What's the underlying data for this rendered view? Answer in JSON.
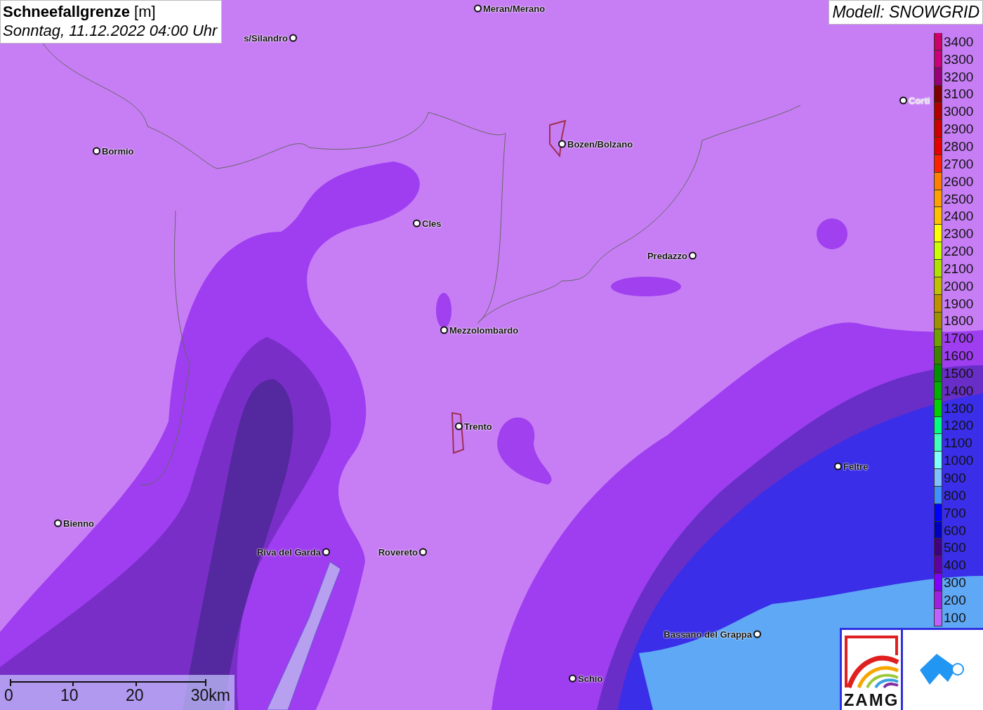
{
  "header": {
    "title": "Schneefallgrenze",
    "unit": "[m]",
    "datetime": "Sonntag, 11.12.2022 04:00 Uhr"
  },
  "model_label": "Modell: SNOWGRID",
  "legend": [
    {
      "value": "3400",
      "color": "#cc0066"
    },
    {
      "value": "3300",
      "color": "#c8007a"
    },
    {
      "value": "3200",
      "color": "#990077"
    },
    {
      "value": "3100",
      "color": "#800000"
    },
    {
      "value": "3000",
      "color": "#b00000"
    },
    {
      "value": "2900",
      "color": "#cc0000"
    },
    {
      "value": "2800",
      "color": "#e60000"
    },
    {
      "value": "2700",
      "color": "#ff2200"
    },
    {
      "value": "2600",
      "color": "#ff8000"
    },
    {
      "value": "2500",
      "color": "#ffa000"
    },
    {
      "value": "2400",
      "color": "#ffc000"
    },
    {
      "value": "2300",
      "color": "#ffff00"
    },
    {
      "value": "2200",
      "color": "#ccff00"
    },
    {
      "value": "2100",
      "color": "#b0e000"
    },
    {
      "value": "2000",
      "color": "#c0c000"
    },
    {
      "value": "1900",
      "color": "#c09000"
    },
    {
      "value": "1800",
      "color": "#a09000"
    },
    {
      "value": "1700",
      "color": "#70a000"
    },
    {
      "value": "1600",
      "color": "#408000"
    },
    {
      "value": "1500",
      "color": "#009000"
    },
    {
      "value": "1400",
      "color": "#00b000"
    },
    {
      "value": "1300",
      "color": "#00d000"
    },
    {
      "value": "1200",
      "color": "#00ff80"
    },
    {
      "value": "1100",
      "color": "#40ffc0"
    },
    {
      "value": "1000",
      "color": "#80ffff"
    },
    {
      "value": "900",
      "color": "#80c0ff"
    },
    {
      "value": "800",
      "color": "#4090ff"
    },
    {
      "value": "700",
      "color": "#0000ff"
    },
    {
      "value": "600",
      "color": "#0000c0"
    },
    {
      "value": "500",
      "color": "#400080"
    },
    {
      "value": "400",
      "color": "#6000a0"
    },
    {
      "value": "300",
      "color": "#8000ff"
    },
    {
      "value": "200",
      "color": "#a020e0"
    },
    {
      "value": "100",
      "color": "#c060ff"
    }
  ],
  "cities": [
    {
      "name": "Meran/Merano"
    },
    {
      "name": "s/Silandro"
    },
    {
      "name": "Bormio"
    },
    {
      "name": "Bozen/Bolzano"
    },
    {
      "name": "Cles"
    },
    {
      "name": "Predazzo"
    },
    {
      "name": "Mezzolombardo"
    },
    {
      "name": "Trento"
    },
    {
      "name": "Feltre"
    },
    {
      "name": "Bienno"
    },
    {
      "name": "Riva del Garda"
    },
    {
      "name": "Rovereto"
    },
    {
      "name": "Bassano del Grappa"
    },
    {
      "name": "Schio"
    },
    {
      "name": "Corti"
    }
  ],
  "scale": {
    "ticks": [
      "0",
      "10",
      "20",
      "30km"
    ]
  },
  "logo": {
    "text": "ZAMG"
  }
}
